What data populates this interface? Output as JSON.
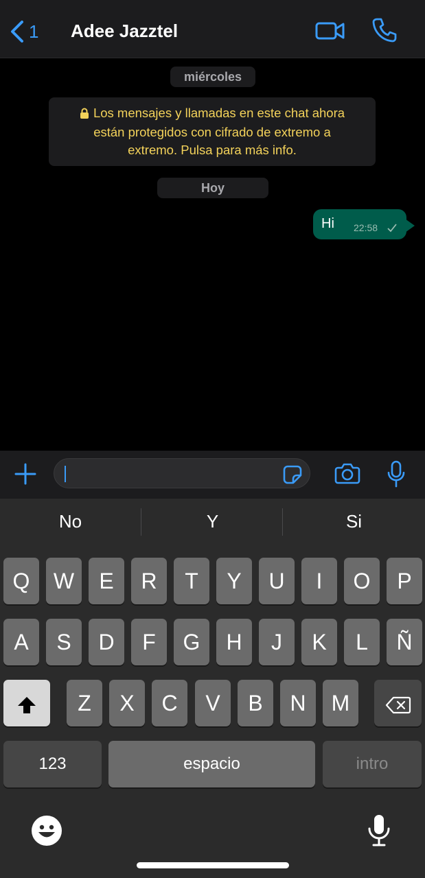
{
  "header": {
    "back_count": "1",
    "contact_name": "Adee Jazztel"
  },
  "chat": {
    "date_wednesday": "miércoles",
    "encryption_notice_line1": "Los mensajes y llamadas en este chat ahora",
    "encryption_notice_line2": "están protegidos con cifrado de extremo a",
    "encryption_notice_line3": "extremo. Pulsa para más info.",
    "date_today": "Hoy",
    "messages": [
      {
        "text": "Hi",
        "time": "22:58",
        "direction": "outgoing",
        "status": "sent-single-check"
      }
    ]
  },
  "composer": {
    "value": "",
    "icons": [
      "plus-icon",
      "sticker-icon",
      "camera-icon",
      "microphone-icon"
    ]
  },
  "keyboard": {
    "suggestions": [
      "No",
      "Y",
      "Si"
    ],
    "row1": [
      "Q",
      "W",
      "E",
      "R",
      "T",
      "Y",
      "U",
      "I",
      "O",
      "P"
    ],
    "row2": [
      "A",
      "S",
      "D",
      "F",
      "G",
      "H",
      "J",
      "K",
      "L",
      "Ñ"
    ],
    "row3": [
      "Z",
      "X",
      "C",
      "V",
      "B",
      "N",
      "M"
    ],
    "numbers_label": "123",
    "space_label": "espacio",
    "return_label": "intro",
    "bottom_icons": [
      "emoji-icon",
      "dictation-icon"
    ]
  },
  "colors": {
    "accent": "#3a9bf8",
    "outgoing_bubble": "#005c4b",
    "notice_text": "#f3d25a",
    "header_bg": "#1c1c1e"
  }
}
